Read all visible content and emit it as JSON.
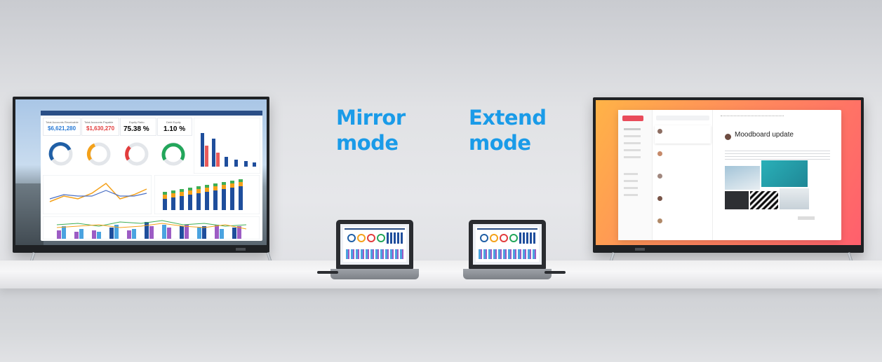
{
  "labels": {
    "mirror": [
      "Mirror",
      "mode"
    ],
    "extend": [
      "Extend",
      "mode"
    ]
  },
  "left_tv_dashboard": {
    "kpis": [
      {
        "label": "Total Accounts Receivable",
        "value": "$6,621,280",
        "color": "#2a7bd6"
      },
      {
        "label": "Total Accounts Payable",
        "value": "$1,630,270",
        "color": "#e23c3c"
      },
      {
        "label": "Equity Ratio",
        "value": "75.38 %",
        "color": "#222222"
      },
      {
        "label": "Debt Equity",
        "value": "1.10 %",
        "color": "#222222"
      }
    ],
    "gauge_colors": [
      "#1f5fa6",
      "#f4a11a",
      "#e23c3c",
      "#22a65a"
    ],
    "bar_colors": [
      "#1f4e9c",
      "#f4a11a",
      "#3fae55",
      "#e85a5a",
      "#9c5cc4",
      "#4aa3e0"
    ]
  },
  "right_tv_email": {
    "title": "Moodboard update",
    "accent": "#e94b5a",
    "wallpaper": [
      "#ffb347",
      "#ff5f6d"
    ]
  },
  "colors": {
    "label_blue": "#1a9be8"
  }
}
